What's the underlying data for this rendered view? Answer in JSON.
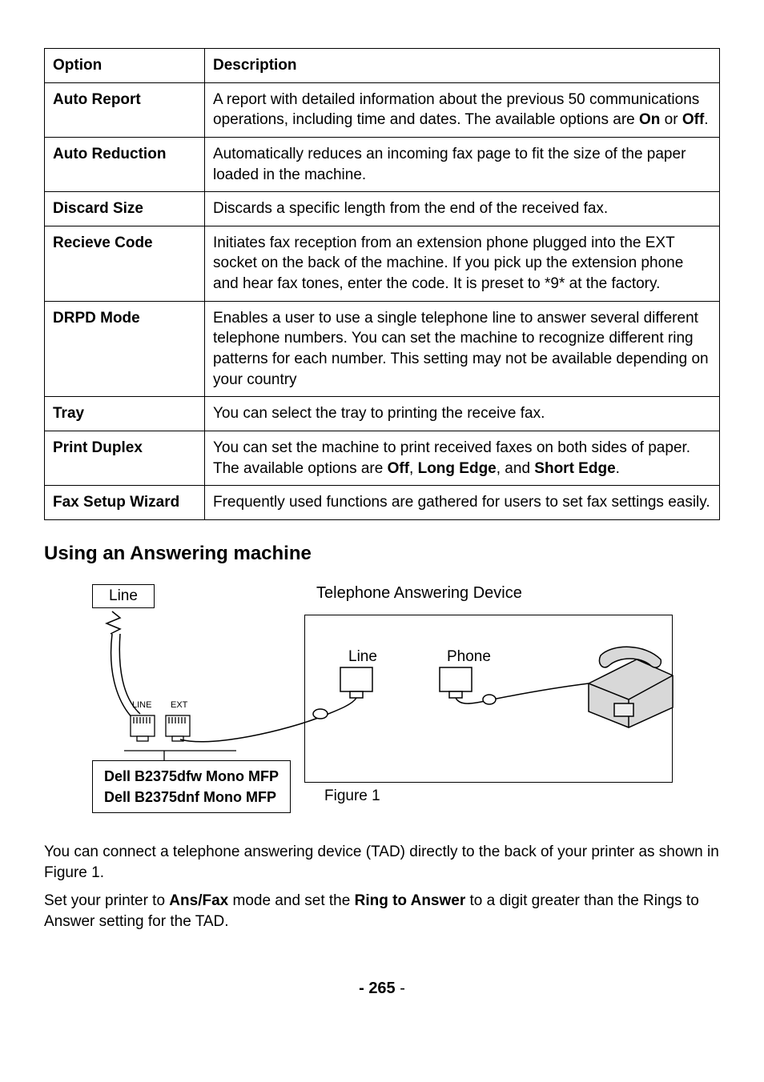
{
  "table": {
    "headers": {
      "option": "Option",
      "description": "Description"
    },
    "rows": [
      {
        "option": "Auto Report",
        "desc_pre": "A report with detailed information about the previous 50 communications operations, including time and dates. The available options are ",
        "bold1": "On",
        "mid": " or ",
        "bold2": "Off",
        "post": "."
      },
      {
        "option": "Auto Reduction",
        "desc": "Automatically reduces an incoming fax page to fit the size of the paper loaded in the machine."
      },
      {
        "option": "Discard Size",
        "desc": "Discards a specific length from the end of the received fax."
      },
      {
        "option": "Recieve Code",
        "desc": "Initiates fax reception from an extension phone plugged into the EXT socket on the back of the machine. If you pick up the extension phone and hear fax tones, enter the code. It is preset to *9* at the factory."
      },
      {
        "option": "DRPD Mode",
        "desc": "Enables a user to use a single telephone line to answer several different telephone numbers. You can set the machine to recognize different ring patterns for each number. This setting may not be available depending on your country"
      },
      {
        "option": "Tray",
        "desc": "You can select the tray to printing the receive fax."
      },
      {
        "option": "Print Duplex",
        "desc_pre": "You can set the machine to print received faxes on both sides of paper. The available options are ",
        "bold1": "Off",
        "mid1": ", ",
        "bold2": "Long Edge",
        "mid2": ", and ",
        "bold3": "Short Edge",
        "post": "."
      },
      {
        "option": "Fax Setup Wizard",
        "desc": "Frequently used functions are gathered for users to set fax settings easily."
      }
    ]
  },
  "section_heading": "Using an Answering machine",
  "diagram": {
    "line_label": "Line",
    "tad_title": "Telephone Answering Device",
    "tad_line": "Line",
    "tad_phone": "Phone",
    "printer1": "Dell B2375dfw Mono MFP",
    "printer2": "Dell B2375dnf Mono MFP",
    "figure": "Figure 1",
    "port_line": "LINE",
    "port_ext": "EXT"
  },
  "paragraphs": {
    "p1": "You can connect a telephone answering device (TAD) directly to the back of your printer as shown in Figure 1.",
    "p2_pre": "Set your printer to ",
    "p2_b1": "Ans/Fax",
    "p2_mid": " mode and set the ",
    "p2_b2": "Ring to Answer",
    "p2_post": " to a digit greater than the Rings to Answer setting for the TAD."
  },
  "page_number": {
    "dash_l": "- ",
    "num": "265",
    "dash_r": " -"
  }
}
